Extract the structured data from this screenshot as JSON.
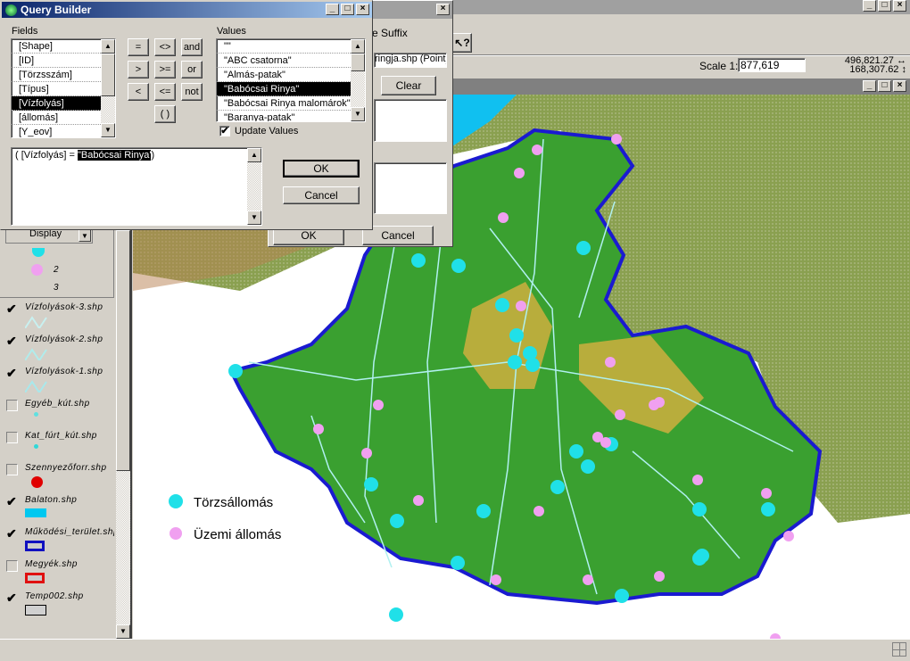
{
  "query_builder": {
    "title": "Query Builder",
    "fields_label": "Fields",
    "fields": [
      "[Shape]",
      "[ID]",
      "[Törzsszám]",
      "[Típus]",
      "[Vízfolyás]",
      "[állomás]",
      "[Y_eov]"
    ],
    "selected_field": 4,
    "operators": [
      "=",
      "<>",
      "and",
      ">",
      ">=",
      "or",
      "<",
      "<=",
      "not",
      "( )"
    ],
    "values_label": "Values",
    "values": [
      "\"\"",
      "\"ABC csatorna\"",
      "\"Almás-patak\"",
      "\"Babócsai Rinya\"",
      "\"Babócsai Rinya malomárok\"",
      "\"Baranya-patak\""
    ],
    "selected_value": 3,
    "update_values_label": "Update Values",
    "update_values_checked": true,
    "expression_prefix": "(  [Vízfolyás] = ",
    "expression_selected": "\"Babócsai Rinya'",
    "expression_suffix": ")",
    "ok_label": "OK",
    "cancel_label": "Cancel"
  },
  "back_dialog": {
    "suffix_label": "e Suffix",
    "layer_field": "ringja.shp (Point)",
    "clear_label": "Clear",
    "ok_label": "OK",
    "cancel_label": "Cancel",
    "display_label": "Display"
  },
  "toolbar": {
    "help_icon": "what-is-this-icon"
  },
  "status": {
    "scale_label": "Scale 1:",
    "scale_value": "877,619",
    "x_coord": "496,821.27",
    "y_coord": "168,307.62"
  },
  "legend": {
    "class_labels": [
      "2",
      "3"
    ],
    "layers": [
      {
        "name": "Vízfolyások-3.shp",
        "checked": true,
        "symbol": "line",
        "color": "#c8f0f0"
      },
      {
        "name": "Vízfolyások-2.shp",
        "checked": true,
        "symbol": "line",
        "color": "#b0ecec"
      },
      {
        "name": "Vízfolyások-1.shp",
        "checked": true,
        "symbol": "line",
        "color": "#a8e8ec"
      },
      {
        "name": "Egyéb_kút.shp",
        "checked": false,
        "symbol": "dot",
        "color": "#60e0e0"
      },
      {
        "name": "Kat_fúrt_kút.shp",
        "checked": false,
        "symbol": "dot",
        "color": "#30d8d8"
      },
      {
        "name": "Szennyezőforr.shp",
        "checked": false,
        "symbol": "circle",
        "color": "#e00000"
      },
      {
        "name": "Balaton.shp",
        "checked": true,
        "symbol": "fill",
        "color": "#00c8f0"
      },
      {
        "name": "Működési_terület.shp",
        "checked": true,
        "symbol": "outline",
        "color": "#1010c0"
      },
      {
        "name": "Megyék.shp",
        "checked": false,
        "symbol": "outline",
        "color": "#e01010"
      },
      {
        "name": "Temp002.shp",
        "checked": true,
        "symbol": "hatch",
        "color": "#d0d0d0"
      }
    ]
  },
  "map": {
    "legend_items": [
      {
        "label": "Törzsállomás",
        "color": "#20e0e8"
      },
      {
        "label": "Üzemi állomás",
        "color": "#f0a0f0"
      }
    ],
    "colors": {
      "boundary": "#1a1ad0",
      "lowland": "#3aa030",
      "hills": "#d8b040",
      "lake": "#10c0f0",
      "outside": "#8aa050"
    }
  }
}
